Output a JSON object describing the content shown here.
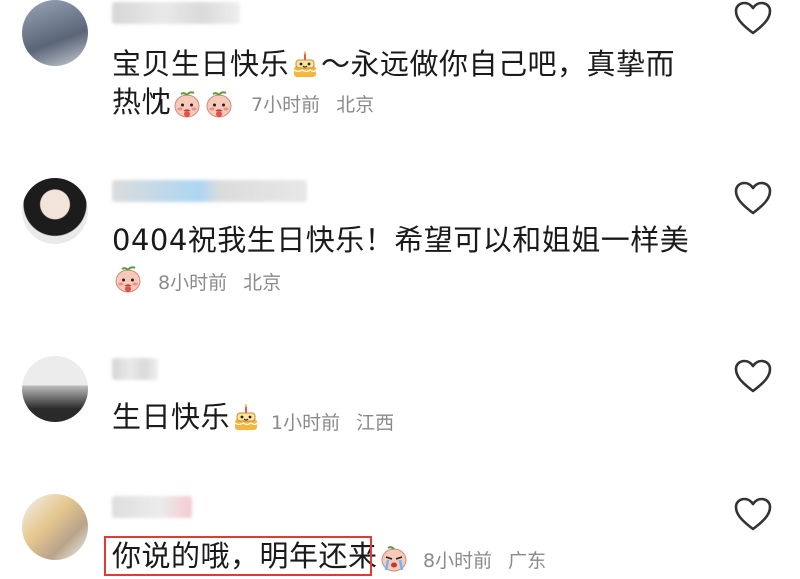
{
  "comments": [
    {
      "line1": "宝贝生日快乐",
      "line1_after": "～永远做你自己吧，真挚而",
      "line2": "热忱",
      "time": "7小时前",
      "location": "北京",
      "emojis_inline": [
        "cake-emoji"
      ],
      "emojis_line2": [
        "peach-baby-emoji",
        "peach-baby-emoji"
      ]
    },
    {
      "line1": "0404祝我生日快乐！希望可以和姐姐一样美",
      "time": "8小时前",
      "location": "北京",
      "emojis_meta": [
        "peach-baby-emoji"
      ]
    },
    {
      "line1": "生日快乐",
      "time": "1小时前",
      "location": "江西",
      "emojis_inline": [
        "cake-emoji"
      ]
    },
    {
      "line1": "你说的哦，明年还来",
      "time": "8小时前",
      "location": "广东",
      "emojis_inline": [
        "crying-peach-emoji"
      ]
    }
  ],
  "colors": {
    "highlight": "#e23b33",
    "meta_text": "#8a8a8a",
    "heart_stroke": "#333333"
  }
}
